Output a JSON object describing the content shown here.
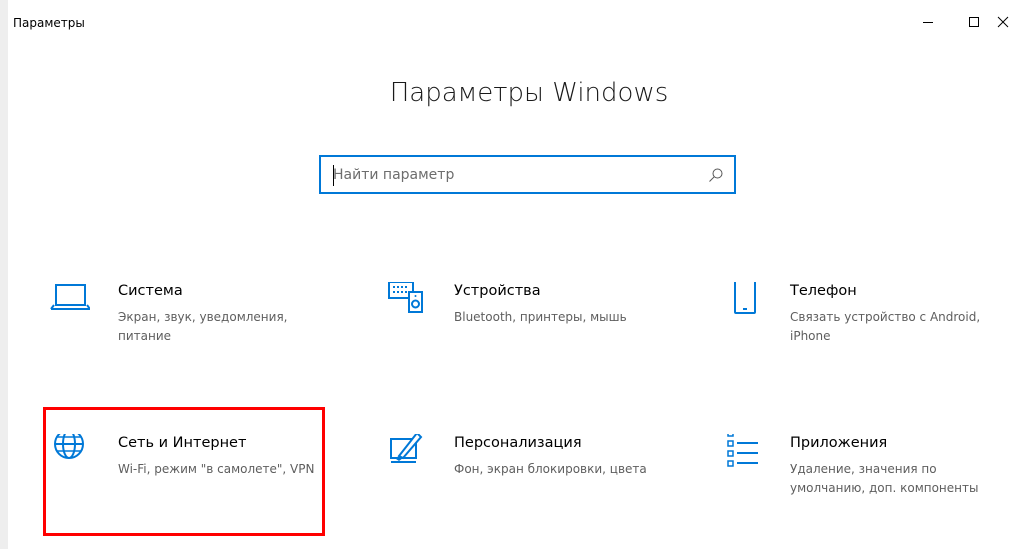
{
  "window": {
    "title": "Параметры"
  },
  "heading": "Параметры Windows",
  "search": {
    "placeholder": "Найти параметр",
    "value": ""
  },
  "tiles": [
    {
      "name": "Система",
      "desc": "Экран, звук, уведомления, питание",
      "icon": "laptop-icon"
    },
    {
      "name": "Устройства",
      "desc": "Bluetooth, принтеры, мышь",
      "icon": "devices-icon"
    },
    {
      "name": "Телефон",
      "desc": "Связать устройство с Android, iPhone",
      "icon": "phone-icon"
    },
    {
      "name": "Сеть и Интернет",
      "desc": "Wi-Fi, режим \"в самолете\", VPN",
      "icon": "globe-icon"
    },
    {
      "name": "Персонализация",
      "desc": "Фон, экран блокировки, цвета",
      "icon": "personalization-icon"
    },
    {
      "name": "Приложения",
      "desc": "Удаление, значения по умолчанию, доп. компоненты",
      "icon": "apps-list-icon"
    }
  ],
  "colors": {
    "accent": "#0078d7",
    "highlight": "#ff0000",
    "description_text": "#5e5e5e"
  }
}
